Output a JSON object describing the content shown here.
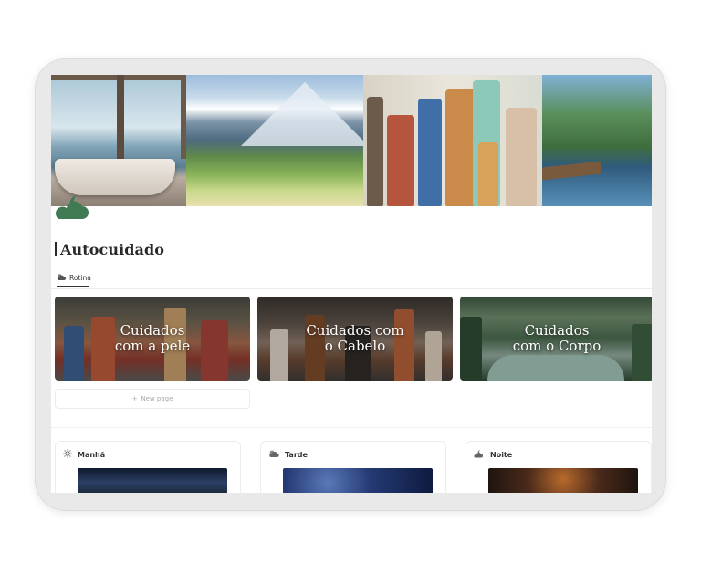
{
  "page": {
    "title": "Autocuidado"
  },
  "view_tab": {
    "label": "Rotina",
    "icon": "sun-behind-cloud-icon"
  },
  "gallery": {
    "cards": [
      {
        "label": "Cuidados\ncom a pele"
      },
      {
        "label": "Cuidados com\no Cabelo"
      },
      {
        "label": "Cuidados\ncom o Corpo"
      }
    ],
    "new_page_label": "New page"
  },
  "routines": [
    {
      "label": "Manhã",
      "icon": "sun-icon"
    },
    {
      "label": "Tarde",
      "icon": "sun-behind-cloud-icon"
    },
    {
      "label": "Noite",
      "icon": "cloud-moon-icon"
    }
  ],
  "colors": {
    "page_icon": "#3f7a52",
    "accent_text": "#2a2a2a",
    "muted_text": "#a8a8a8"
  }
}
